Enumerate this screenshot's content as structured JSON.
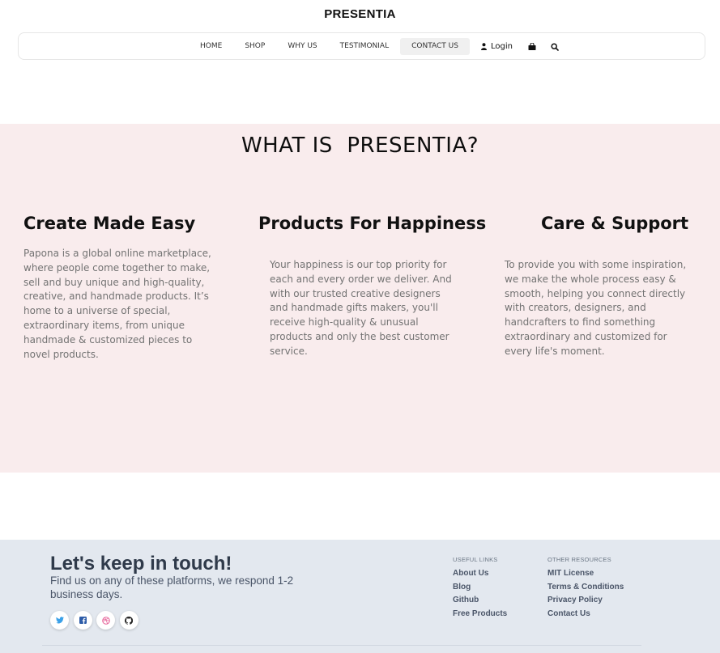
{
  "brand": "PRESENTIA",
  "nav": {
    "links": [
      "HOME",
      "SHOP",
      "WHY US",
      "TESTIMONIAL",
      "CONTACT US"
    ],
    "active": "CONTACT US",
    "login_label": "Login",
    "icons": [
      "user-icon",
      "shopping-bag-icon",
      "search-icon"
    ]
  },
  "about": {
    "title": "WHAT IS  PRESENTIA?",
    "features": [
      {
        "title": "Create Made Easy",
        "text": "Papona is a global online marketplace, where people come together to make, sell and buy unique and high-quality, creative, and handmade products. It’s home to a universe of special, extraordinary items, from unique handmade & customized pieces to novel products."
      },
      {
        "title": "Products For Happiness",
        "text": "Your happiness is our top priority for each and every order we deliver. And with our trusted creative designers and handmade gifts makers, you'll receive high-quality & unusual products and only the best customer service."
      },
      {
        "title": "Care & Support",
        "text": "To provide you with some inspiration, we make the whole process easy & smooth, helping you connect directly with creators, designers, and handcrafters to find something extraordinary and customized for every life's moment."
      }
    ],
    "background": "#f9eced"
  },
  "footer": {
    "title": "Let's keep in touch!",
    "subtitle": "Find us on any of these platforms, we respond 1-2 business days.",
    "socials": [
      "twitter-icon",
      "facebook-icon",
      "dribbble-icon",
      "github-icon"
    ],
    "useful_links": {
      "heading": "USEFUL LINKS",
      "items": [
        "About Us",
        "Blog",
        "Github",
        "Free Products"
      ]
    },
    "other_resources": {
      "heading": "OTHER RESOURCES",
      "items": [
        "MIT License",
        "Terms & Conditions",
        "Privacy Policy",
        "Contact Us"
      ]
    },
    "background": "#e3e8ef"
  }
}
